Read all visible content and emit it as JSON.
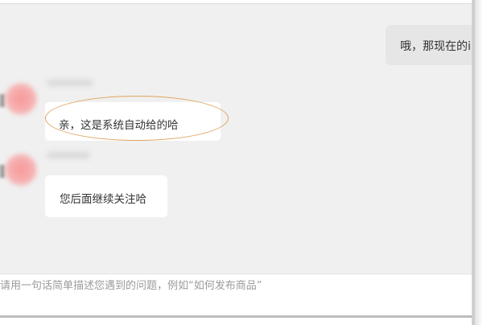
{
  "chat": {
    "outgoing_message": "哦，那现在的i",
    "incoming_messages": [
      {
        "text": "亲，这是系统自动给的哈"
      },
      {
        "text": "您后面继续关注哈"
      }
    ]
  },
  "input": {
    "placeholder": "请用一句话简单描述您遇到的问题，例如“如何发布商品”"
  },
  "colors": {
    "chat_background": "#f0f0f0",
    "incoming_bubble": "#ffffff",
    "outgoing_bubble": "#e6e6e6",
    "highlight_ellipse": "#e0a35c",
    "avatar": "#f5a0a0"
  }
}
